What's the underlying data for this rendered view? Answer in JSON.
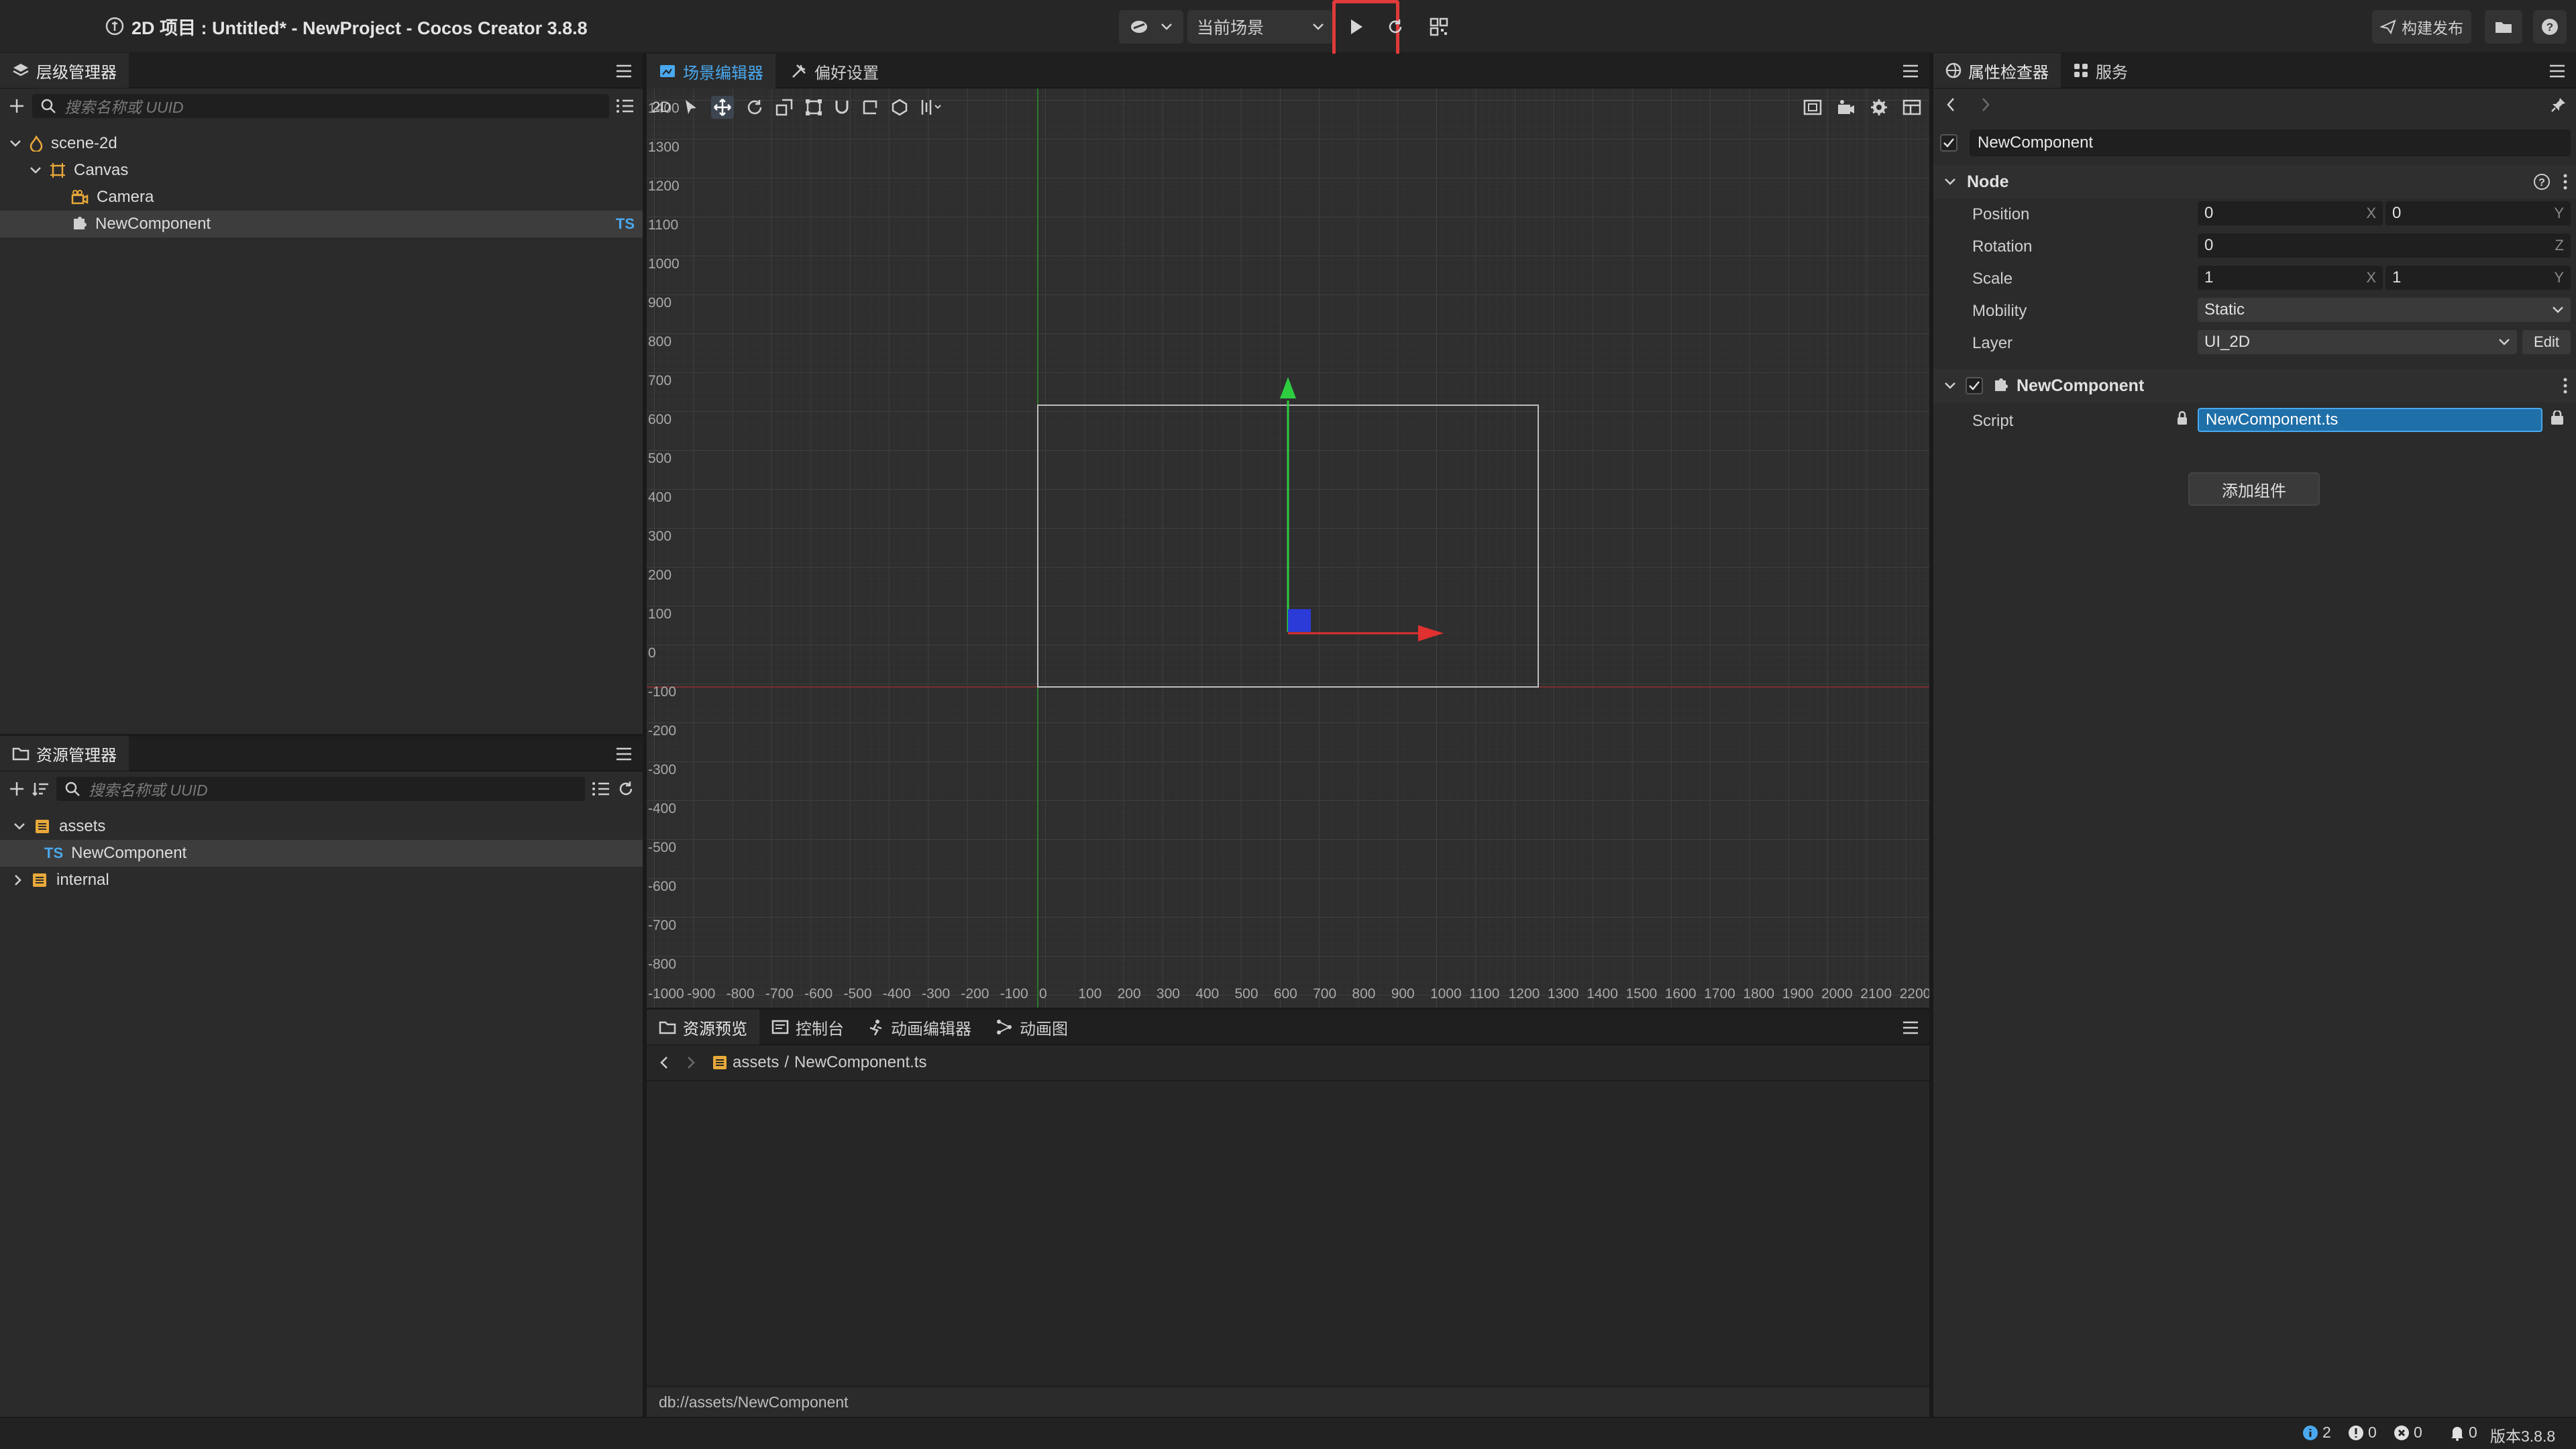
{
  "window": {
    "title": "2D 项目 : Untitled* - NewProject - Cocos Creator 3.8.8"
  },
  "toolbar": {
    "scene_select": "当前场景",
    "build_publish": "构建发布",
    "accent_highlight": "#e03a3a"
  },
  "hierarchy": {
    "tab": "层级管理器",
    "search_placeholder": "搜索名称或 UUID",
    "items": [
      {
        "label": "scene-2d",
        "icon": "scene-icon"
      },
      {
        "label": "Canvas",
        "icon": "canvas-node-icon"
      },
      {
        "label": "Camera",
        "icon": "camera-node-icon"
      },
      {
        "label": "NewComponent",
        "icon": "component-node-icon",
        "badge": "TS"
      }
    ]
  },
  "assets": {
    "tab": "资源管理器",
    "search_placeholder": "搜索名称或 UUID",
    "items": [
      {
        "label": "assets",
        "icon": "folder-icon"
      },
      {
        "label": "NewComponent",
        "badge": "TS"
      },
      {
        "label": "internal",
        "icon": "folder-icon"
      }
    ]
  },
  "scene_editor": {
    "tabs": [
      "场景编辑器",
      "偏好设置"
    ],
    "mode_2d": "2D",
    "y_ticks": [
      "1400",
      "1300",
      "1200",
      "1100",
      "1000",
      "900",
      "800",
      "700",
      "600",
      "500",
      "400",
      "300",
      "200",
      "100",
      "0",
      "-100",
      "-200",
      "-300",
      "-400",
      "-500",
      "-600",
      "-700",
      "-800"
    ],
    "x_ticks": [
      "-1000",
      "-900",
      "-800",
      "-700",
      "-600",
      "-500",
      "-400",
      "-300",
      "-200",
      "-100",
      "0",
      "100",
      "200",
      "300",
      "400",
      "500",
      "600",
      "700",
      "800",
      "900",
      "1000",
      "1100",
      "1200",
      "1300",
      "1400",
      "1500",
      "1600",
      "1700",
      "1800",
      "1900",
      "2000",
      "2100",
      "2200"
    ]
  },
  "bottom_panel": {
    "tabs": [
      "资源预览",
      "控制台",
      "动画编辑器",
      "动画图"
    ],
    "path_folder": "assets",
    "path_sep": "/",
    "path_file": "NewComponent.ts",
    "footer_path": "db://assets/NewComponent"
  },
  "inspector": {
    "tabs": [
      "属性检查器",
      "服务"
    ],
    "node_name": "NewComponent",
    "node_section": "Node",
    "position": {
      "label": "Position",
      "x": "0",
      "y": "0"
    },
    "rotation": {
      "label": "Rotation",
      "z": "0"
    },
    "scale": {
      "label": "Scale",
      "x": "1",
      "y": "1"
    },
    "mobility": {
      "label": "Mobility",
      "value": "Static"
    },
    "layer": {
      "label": "Layer",
      "value": "UI_2D",
      "edit": "Edit"
    },
    "axis_x": "X",
    "axis_y": "Y",
    "axis_z": "Z",
    "component_section": "NewComponent",
    "script": {
      "label": "Script",
      "value": "NewComponent.ts"
    },
    "add_component": "添加组件"
  },
  "status": {
    "info_count": "2",
    "warn_count": "0",
    "error_count": "0",
    "notify_count": "0",
    "version": "版本3.8.8"
  }
}
